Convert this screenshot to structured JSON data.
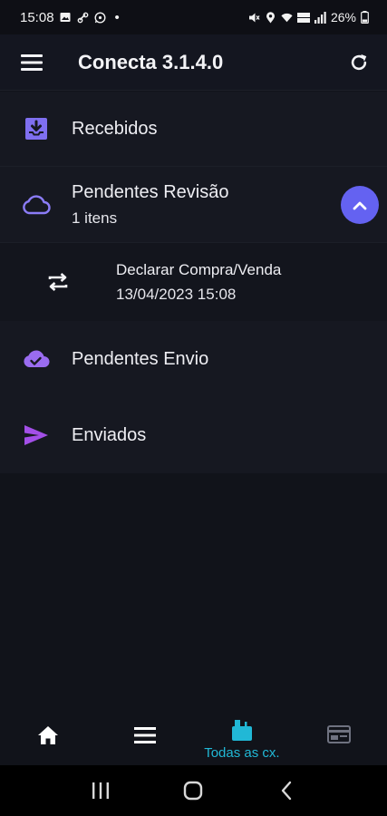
{
  "status_bar": {
    "time": "15:08",
    "dot": "•",
    "battery": "26%",
    "icons": [
      "photo-icon",
      "link-icon",
      "whatsapp-icon",
      "mute-icon",
      "location-icon",
      "wifi-icon",
      "lte-icon",
      "signal-icon",
      "battery-icon"
    ]
  },
  "app_bar": {
    "title": "Conecta 3.1.4.0",
    "menu_icon": "hamburger-icon",
    "refresh_icon": "refresh-icon"
  },
  "list": {
    "recebidos": {
      "label": "Recebidos",
      "icon": "inbox-icon"
    },
    "pendentes_revisao": {
      "label": "Pendentes Revisão",
      "count": "1 itens",
      "icon": "cloud-outline-icon",
      "expanded": true,
      "children": [
        {
          "label": "Declarar Compra/Venda",
          "date": "13/04/2023 15:08",
          "icon": "swap-icon"
        }
      ]
    },
    "pendentes_envio": {
      "label": "Pendentes Envio",
      "icon": "cloud-check-icon"
    },
    "enviados": {
      "label": "Enviados",
      "icon": "send-icon"
    }
  },
  "bottom_nav": {
    "items": [
      {
        "icon": "home-icon",
        "label": ""
      },
      {
        "icon": "list-icon",
        "label": ""
      },
      {
        "icon": "mailbox-icon",
        "label": "Todas as cx.",
        "active": true
      },
      {
        "icon": "card-icon",
        "label": ""
      }
    ]
  },
  "colors": {
    "accent": "#6462f1",
    "active_tab": "#21b8d6",
    "icon_purple": "#8b6cf5",
    "background": "#11131a"
  }
}
